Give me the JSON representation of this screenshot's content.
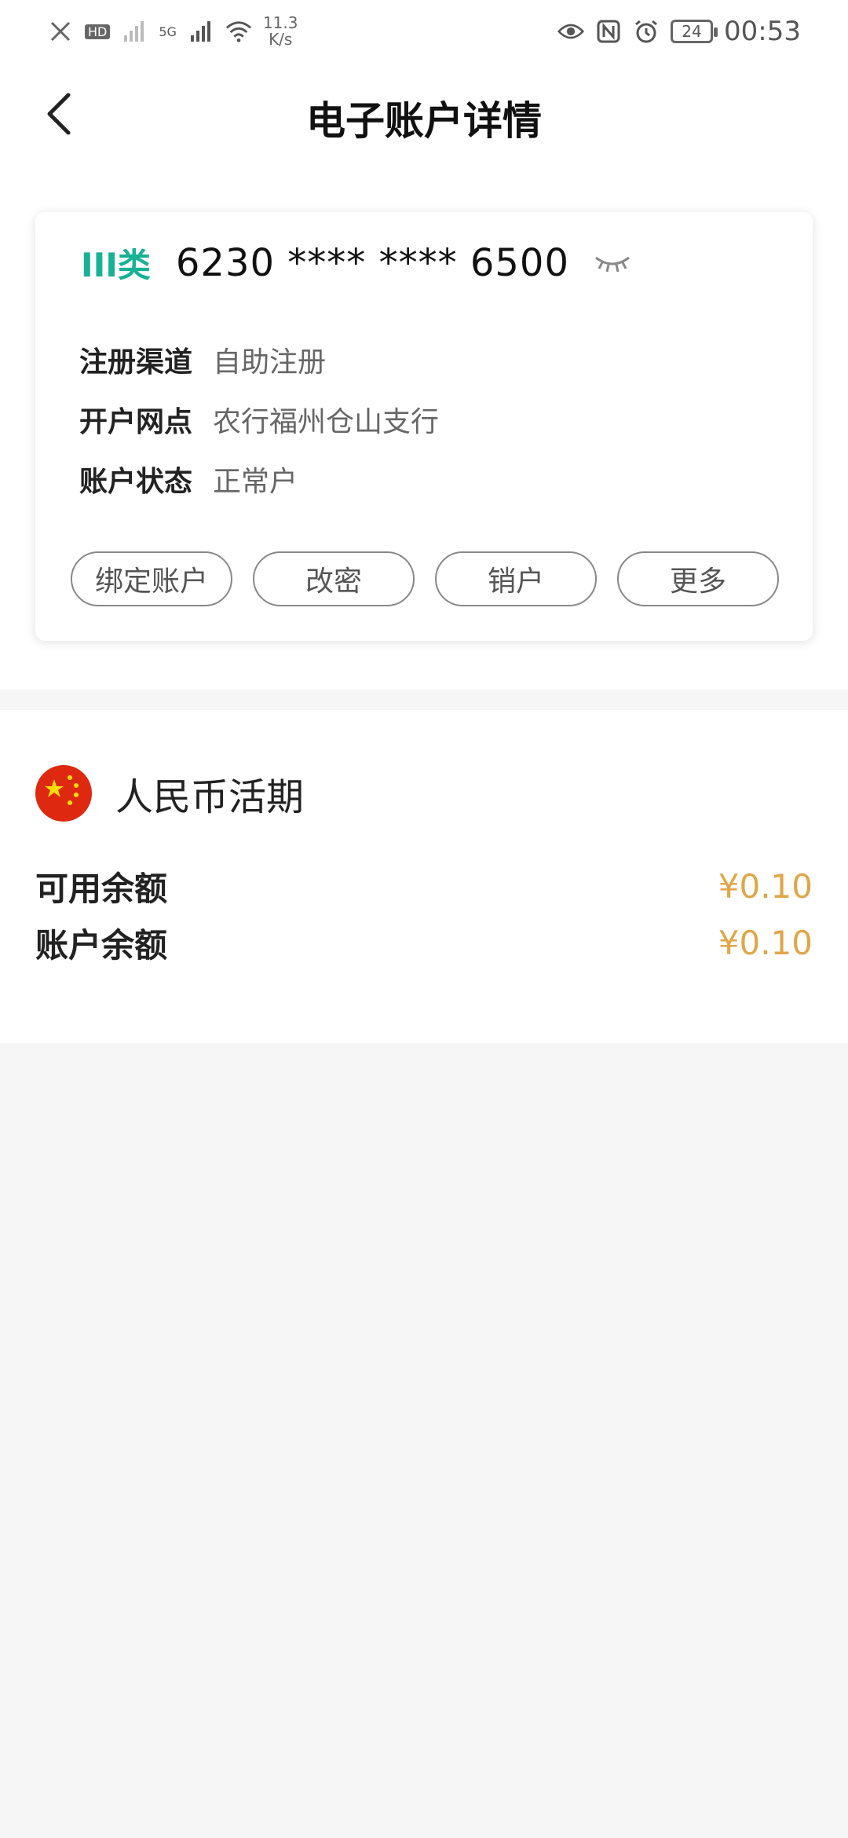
{
  "status_bar": {
    "speed_value": "11.3",
    "speed_unit": "K/s",
    "network": "5G",
    "hd": "HD",
    "battery": "24",
    "time": "00:53"
  },
  "header": {
    "title": "电子账户详情"
  },
  "account": {
    "type": "III类",
    "number": "6230 **** **** 6500",
    "fields": [
      {
        "label": "注册渠道",
        "value": "自助注册"
      },
      {
        "label": "开户网点",
        "value": "农行福州仓山支行"
      },
      {
        "label": "账户状态",
        "value": "正常户"
      }
    ],
    "buttons": [
      "绑定账户",
      "改密",
      "销户",
      "更多"
    ]
  },
  "currency": {
    "title": "人民币活期",
    "available_label": "可用余额",
    "available_value": "¥0.10",
    "balance_label": "账户余额",
    "balance_value": "¥0.10"
  },
  "colors": {
    "accent_green": "#17b196",
    "amount_gold": "#e0a648",
    "background": "#f6f6f6"
  }
}
